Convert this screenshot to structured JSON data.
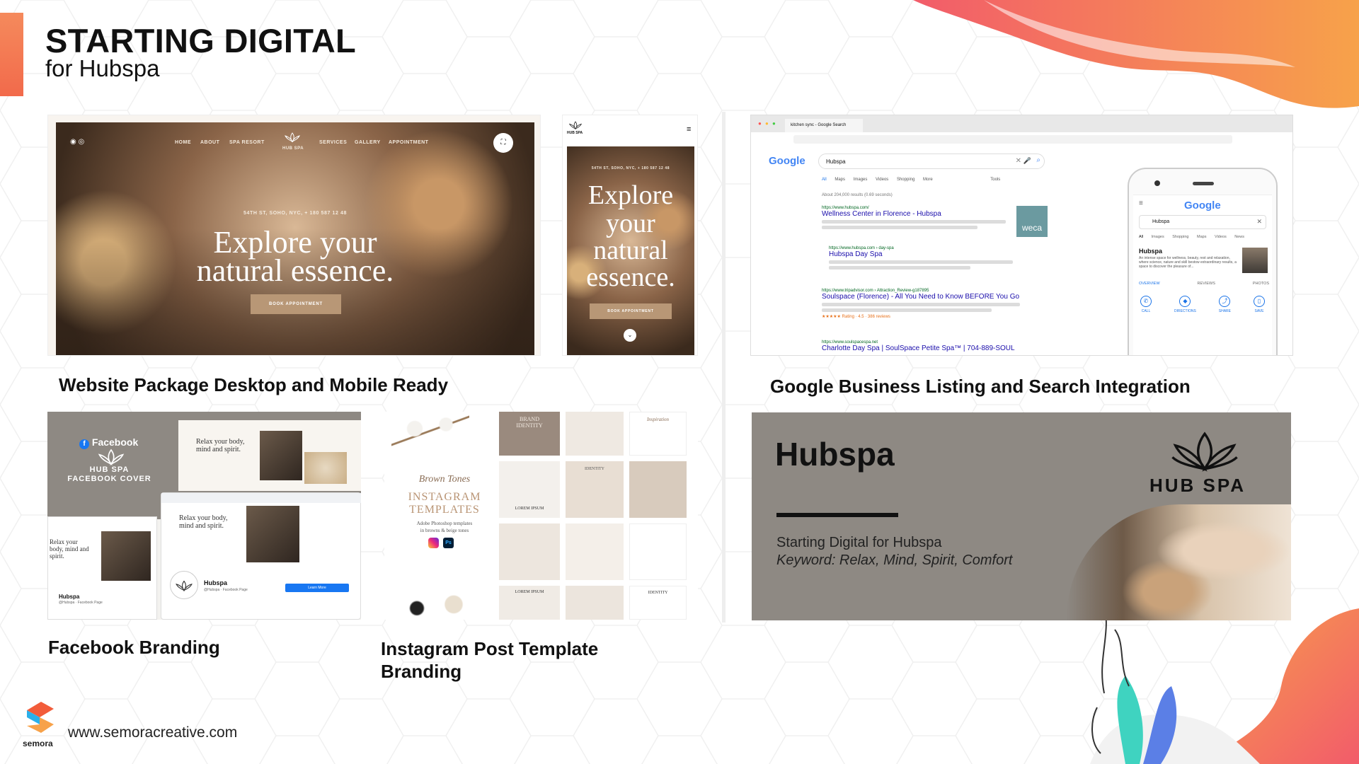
{
  "header": {
    "title": "STARTING DIGITAL",
    "subtitle": "for Hubspa"
  },
  "website": {
    "nav_items": [
      "HOME",
      "ABOUT",
      "SPA RESORT",
      "SERVICES",
      "GALLERY",
      "APPOINTMENT"
    ],
    "brand": "HUB SPA",
    "address": "54TH ST, SOHO, NYC, + 180 587 12 48",
    "hero_line1": "Explore your",
    "hero_line2": "natural essence.",
    "book_button": "BOOK APPOINTMENT",
    "mobile_hero": [
      "Explore",
      "your",
      "natural",
      "essence."
    ],
    "caption": "Website Package Desktop and Mobile Ready"
  },
  "google": {
    "tab_title": "kitchen sync - Google Search",
    "search_query": "Hubspa",
    "logo": "Google",
    "tabs": [
      "All",
      "Maps",
      "Images",
      "Videos",
      "Shopping",
      "More",
      "Tools"
    ],
    "results_count": "About 204,000 results (0.69 seconds)",
    "results": [
      {
        "url": "https://www.hubspa.com/",
        "title": "Wellness Center in Florence - Hubspa"
      },
      {
        "url": "https://www.hubspa.com › day-spa",
        "title": "Hubspa Day Spa"
      },
      {
        "url": "https://www.tripadvisor.com › Attraction_Review-g187895",
        "title": "Soulspace (Florence) - All You Need to Know BEFORE You Go"
      },
      {
        "url": "https://www.soulspacespa.net",
        "title": "Charlotte Day Spa | SoulSpace Petite Spa™ | 704-889-SOUL"
      }
    ],
    "rating": "★★★★★ Rating · 4.5 · 386 reviews",
    "weca_label": "weca",
    "mobile": {
      "logo": "Google",
      "query": "Hubspa",
      "tabs": [
        "All",
        "Images",
        "Shopping",
        "Maps",
        "Videos",
        "News"
      ],
      "listing_name": "Hubspa",
      "listing_desc": "An intense space for wellness, beauty, rest and relaxation, where science, nature and skill bestow extraordinary results, a space to discover the pleasure of...",
      "sections": [
        "OVERVIEW",
        "REVIEWS",
        "PHOTOS"
      ],
      "actions": [
        "CALL",
        "DIRECTIONS",
        "SHARE",
        "SAVE"
      ]
    },
    "caption": "Google Business Listing and Search Integration"
  },
  "facebook": {
    "logo_text": "Facebook",
    "brand": "HUB SPA",
    "cover_label": "FACEBOOK COVER",
    "tagline": "Relax your body, mind and spirit.",
    "page_name": "Hubspa",
    "page_handle": "@Hubspa · Facebook Page",
    "learn_more": "Learn More",
    "caption": "Facebook Branding"
  },
  "instagram": {
    "script_name": "Brown Tones",
    "title_line1": "INSTAGRAM",
    "title_line2": "TEMPLATES",
    "desc_line1": "Adobe Photoshop templates",
    "desc_line2": "in browns & beige tones",
    "grid_labels": [
      "BRAND IDENTITY",
      "Inspiration",
      "LOREM IPSUM",
      "IDENTITY",
      "LOREM IPSUM",
      "IDENTITY"
    ],
    "caption_line1": "Instagram Post Template",
    "caption_line2": "Branding"
  },
  "hubspa_card": {
    "title": "Hubspa",
    "brand": "HUB SPA",
    "line1": "Starting Digital for Hubspa",
    "line2": "Keyword: Relax, Mind, Spirit, Comfort"
  },
  "footer": {
    "logo_text": "semora",
    "url": "www.semoracreative.com"
  },
  "colors": {
    "accent_orange": "#f26a4b",
    "card_gray": "#8e8983",
    "warm_brown": "#b89776"
  }
}
